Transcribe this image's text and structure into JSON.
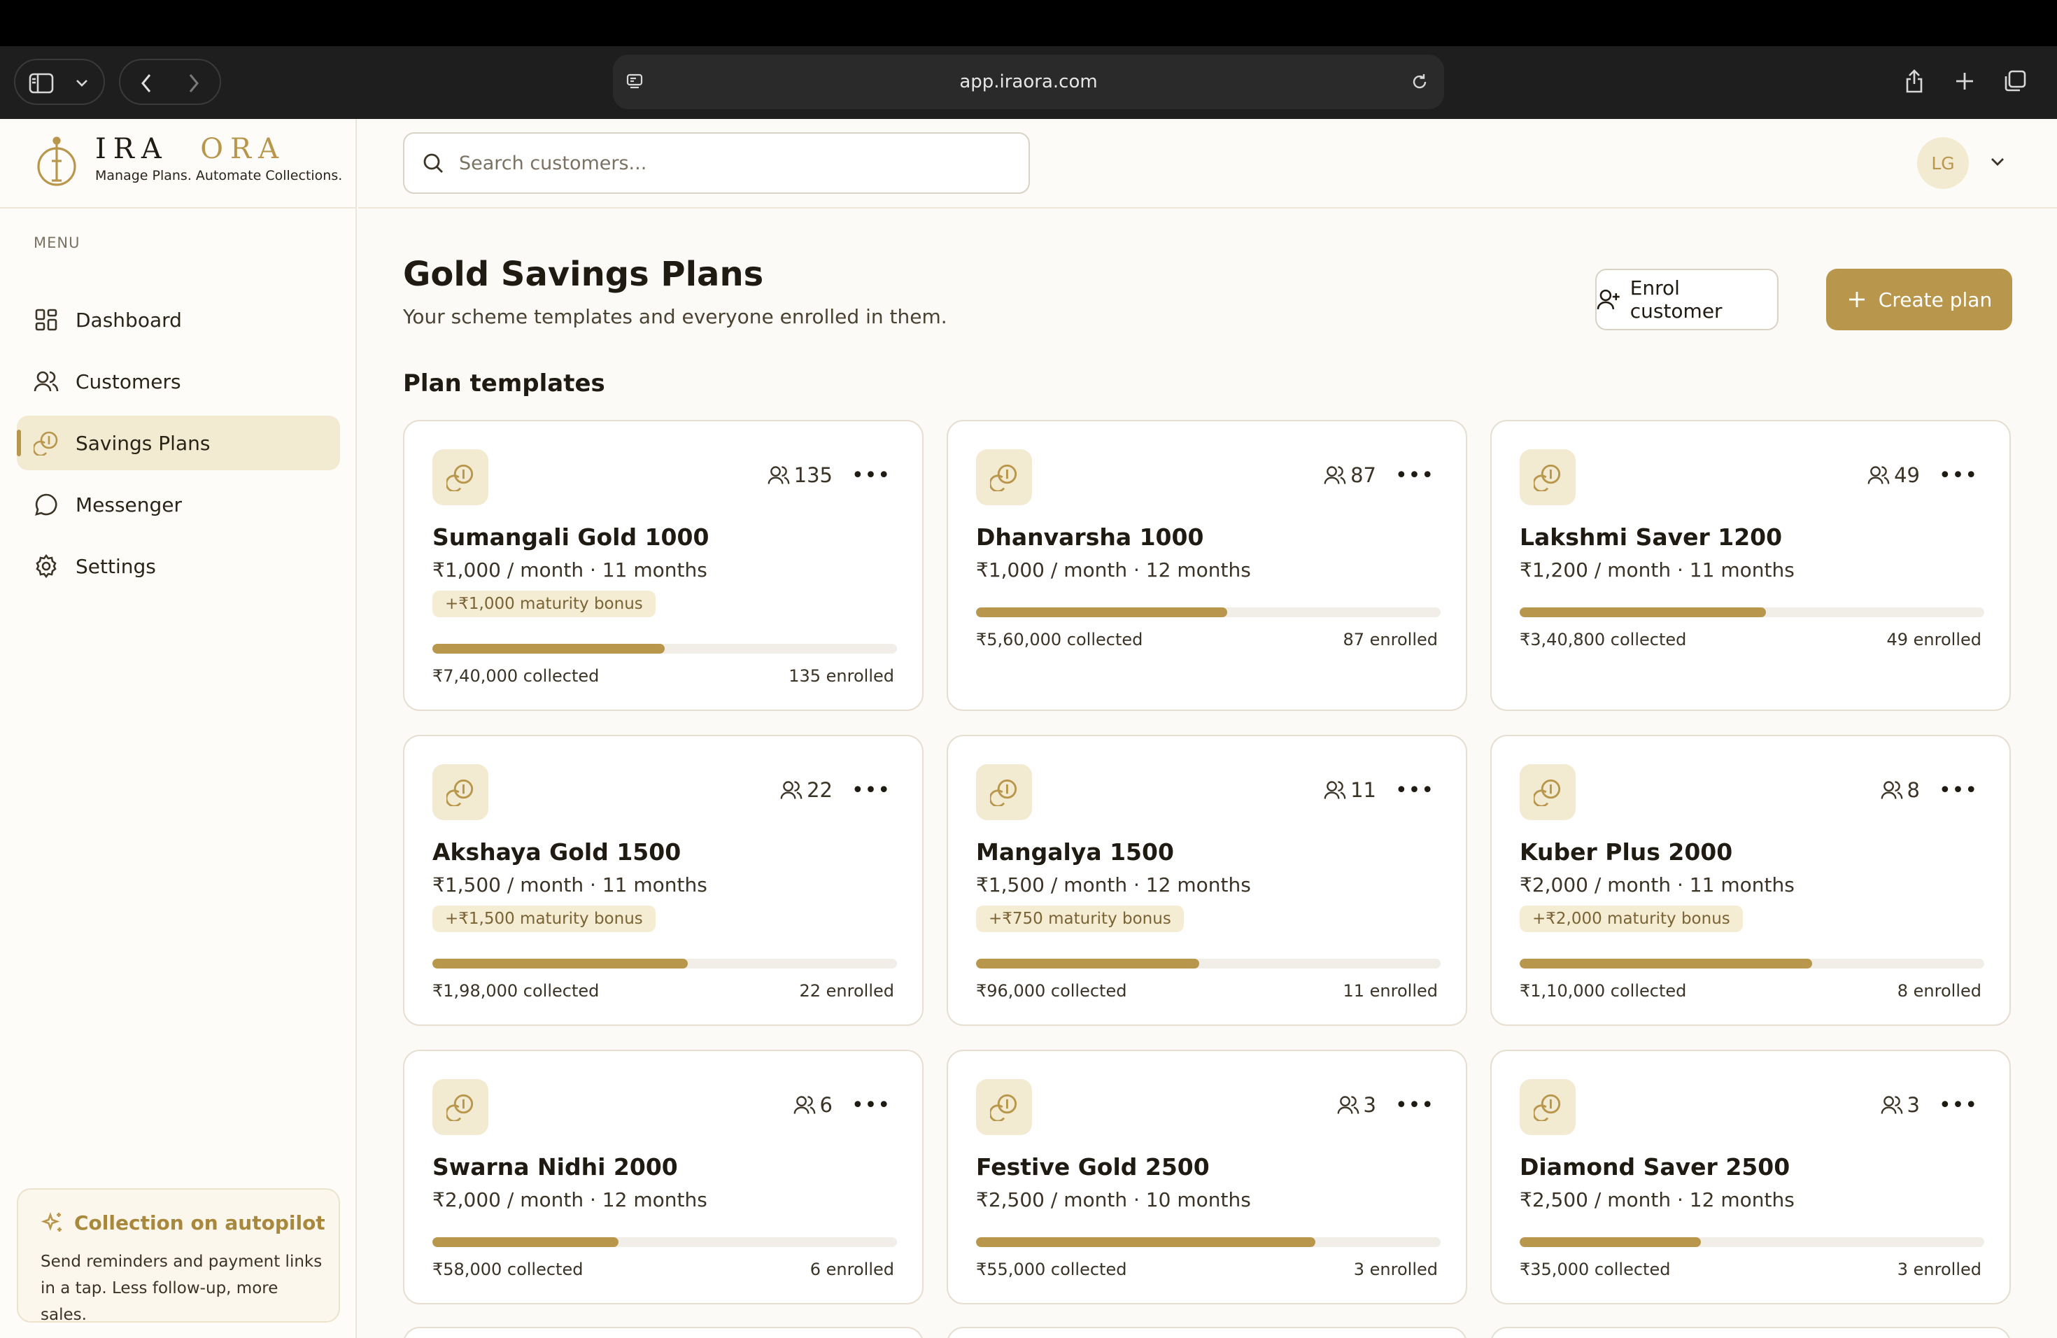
{
  "browser": {
    "url": "app.iraora.com"
  },
  "brand": {
    "name_part1": "IRA",
    "name_part2": "ORA",
    "tagline": "Manage Plans. Automate Collections."
  },
  "sidebar": {
    "menu_title": "MENU",
    "items": [
      {
        "label": "Dashboard",
        "icon": "dashboard-icon",
        "active": false
      },
      {
        "label": "Customers",
        "icon": "users-icon",
        "active": false
      },
      {
        "label": "Savings Plans",
        "icon": "coins-icon",
        "active": true
      },
      {
        "label": "Messenger",
        "icon": "chat-icon",
        "active": false
      },
      {
        "label": "Settings",
        "icon": "gear-icon",
        "active": false
      }
    ],
    "promo": {
      "title": "Collection on autopilot",
      "text": "Send reminders and payment links in a tap. Less follow-up, more sales."
    }
  },
  "header": {
    "search_placeholder": "Search customers...",
    "avatar_initials": "LG"
  },
  "main": {
    "title": "Gold Savings Plans",
    "subtitle": "Your scheme templates and everyone enrolled in them.",
    "enrol_label": "Enrol customer",
    "create_label": "Create plan",
    "section_title": "Plan templates"
  },
  "plans": [
    {
      "name": "Sumangali Gold 1000",
      "terms": "₹1,000 / month · 11 months",
      "bonus": "+₹1,000 maturity bonus",
      "count": "135",
      "collected": "₹7,40,000 collected",
      "enrolled": "135 enrolled",
      "progress": 0.5
    },
    {
      "name": "Dhanvarsha 1000",
      "terms": "₹1,000 / month · 12 months",
      "bonus": "",
      "count": "87",
      "collected": "₹5,60,000 collected",
      "enrolled": "87 enrolled",
      "progress": 0.54
    },
    {
      "name": "Lakshmi Saver 1200",
      "terms": "₹1,200 / month · 11 months",
      "bonus": "",
      "count": "49",
      "collected": "₹3,40,800 collected",
      "enrolled": "49 enrolled",
      "progress": 0.53
    },
    {
      "name": "Akshaya Gold 1500",
      "terms": "₹1,500 / month · 11 months",
      "bonus": "+₹1,500 maturity bonus",
      "count": "22",
      "collected": "₹1,98,000 collected",
      "enrolled": "22 enrolled",
      "progress": 0.55
    },
    {
      "name": "Mangalya 1500",
      "terms": "₹1,500 / month · 12 months",
      "bonus": "+₹750 maturity bonus",
      "count": "11",
      "collected": "₹96,000 collected",
      "enrolled": "11 enrolled",
      "progress": 0.48
    },
    {
      "name": "Kuber Plus 2000",
      "terms": "₹2,000 / month · 11 months",
      "bonus": "+₹2,000 maturity bonus",
      "count": "8",
      "collected": "₹1,10,000 collected",
      "enrolled": "8 enrolled",
      "progress": 0.63
    },
    {
      "name": "Swarna Nidhi 2000",
      "terms": "₹2,000 / month · 12 months",
      "bonus": "",
      "count": "6",
      "collected": "₹58,000 collected",
      "enrolled": "6 enrolled",
      "progress": 0.4
    },
    {
      "name": "Festive Gold 2500",
      "terms": "₹2,500 / month · 10 months",
      "bonus": "",
      "count": "3",
      "collected": "₹55,000 collected",
      "enrolled": "3 enrolled",
      "progress": 0.73
    },
    {
      "name": "Diamond Saver 2500",
      "terms": "₹2,500 / month · 12 months",
      "bonus": "",
      "count": "3",
      "collected": "₹35,000 collected",
      "enrolled": "3 enrolled",
      "progress": 0.39
    }
  ],
  "colors": {
    "accent": "#b8974c",
    "accent_soft": "#f3ead2",
    "border": "#e6dfd1"
  }
}
